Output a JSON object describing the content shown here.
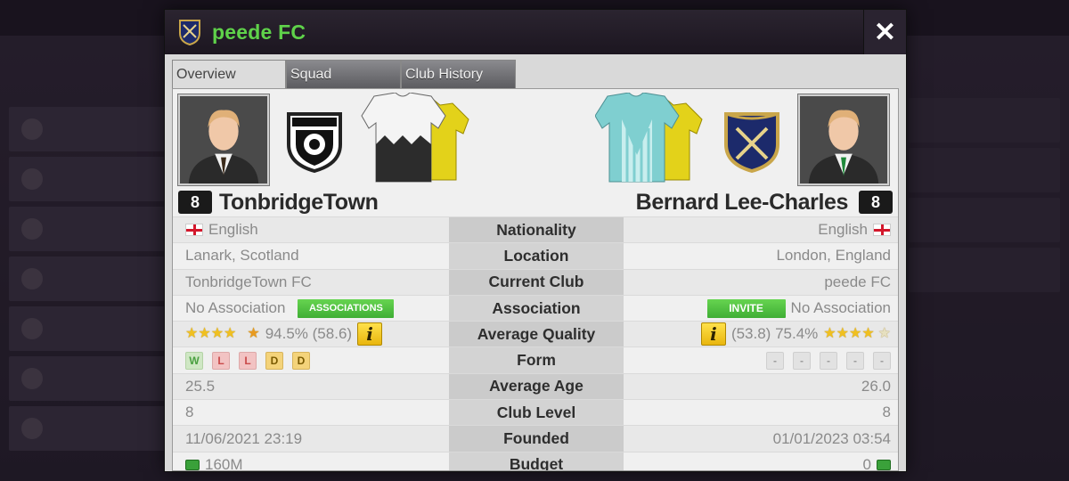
{
  "modal": {
    "title": "peede FC",
    "close_icon": "✕"
  },
  "tabs": [
    {
      "label": "Overview",
      "active": true
    },
    {
      "label": "Squad",
      "active": false
    },
    {
      "label": "Club History",
      "active": false
    }
  ],
  "left_manager": {
    "level": "8",
    "name": "TonbridgeTown"
  },
  "right_manager": {
    "level": "8",
    "name": "Bernard Lee-Charles"
  },
  "rows": {
    "nationality": {
      "label": "Nationality",
      "left": "English",
      "right": "English"
    },
    "location": {
      "label": "Location",
      "left": "Lanark, Scotland",
      "right": "London, England"
    },
    "current_club": {
      "label": "Current Club",
      "left": "TonbridgeTown FC",
      "right": "peede FC"
    },
    "association": {
      "label": "Association",
      "left": "No Association",
      "left_button": "ASSOCIATIONS",
      "right": "No Association",
      "right_button": "INVITE"
    },
    "average_quality": {
      "label": "Average Quality",
      "left": "94.5% (58.6)",
      "right_a": "(53.8) 75.4%",
      "left_stars": 4.5,
      "right_stars": 4.5
    },
    "form": {
      "label": "Form",
      "left": [
        "W",
        "L",
        "L",
        "D",
        "D"
      ],
      "right": [
        "-",
        "-",
        "-",
        "-",
        "-"
      ]
    },
    "average_age": {
      "label": "Average Age",
      "left": "25.5",
      "right": "26.0"
    },
    "club_level": {
      "label": "Club Level",
      "left": "8",
      "right": "8"
    },
    "founded": {
      "label": "Founded",
      "left": "11/06/2021 23:19",
      "right": "01/01/2023 03:54"
    },
    "budget": {
      "label": "Budget",
      "left": "160M",
      "right": "0"
    }
  },
  "info_icon": "i",
  "colors": {
    "title_green": "#5fd24a",
    "button_green": "#4fc23e",
    "info_yellow": "#f2c52a"
  }
}
